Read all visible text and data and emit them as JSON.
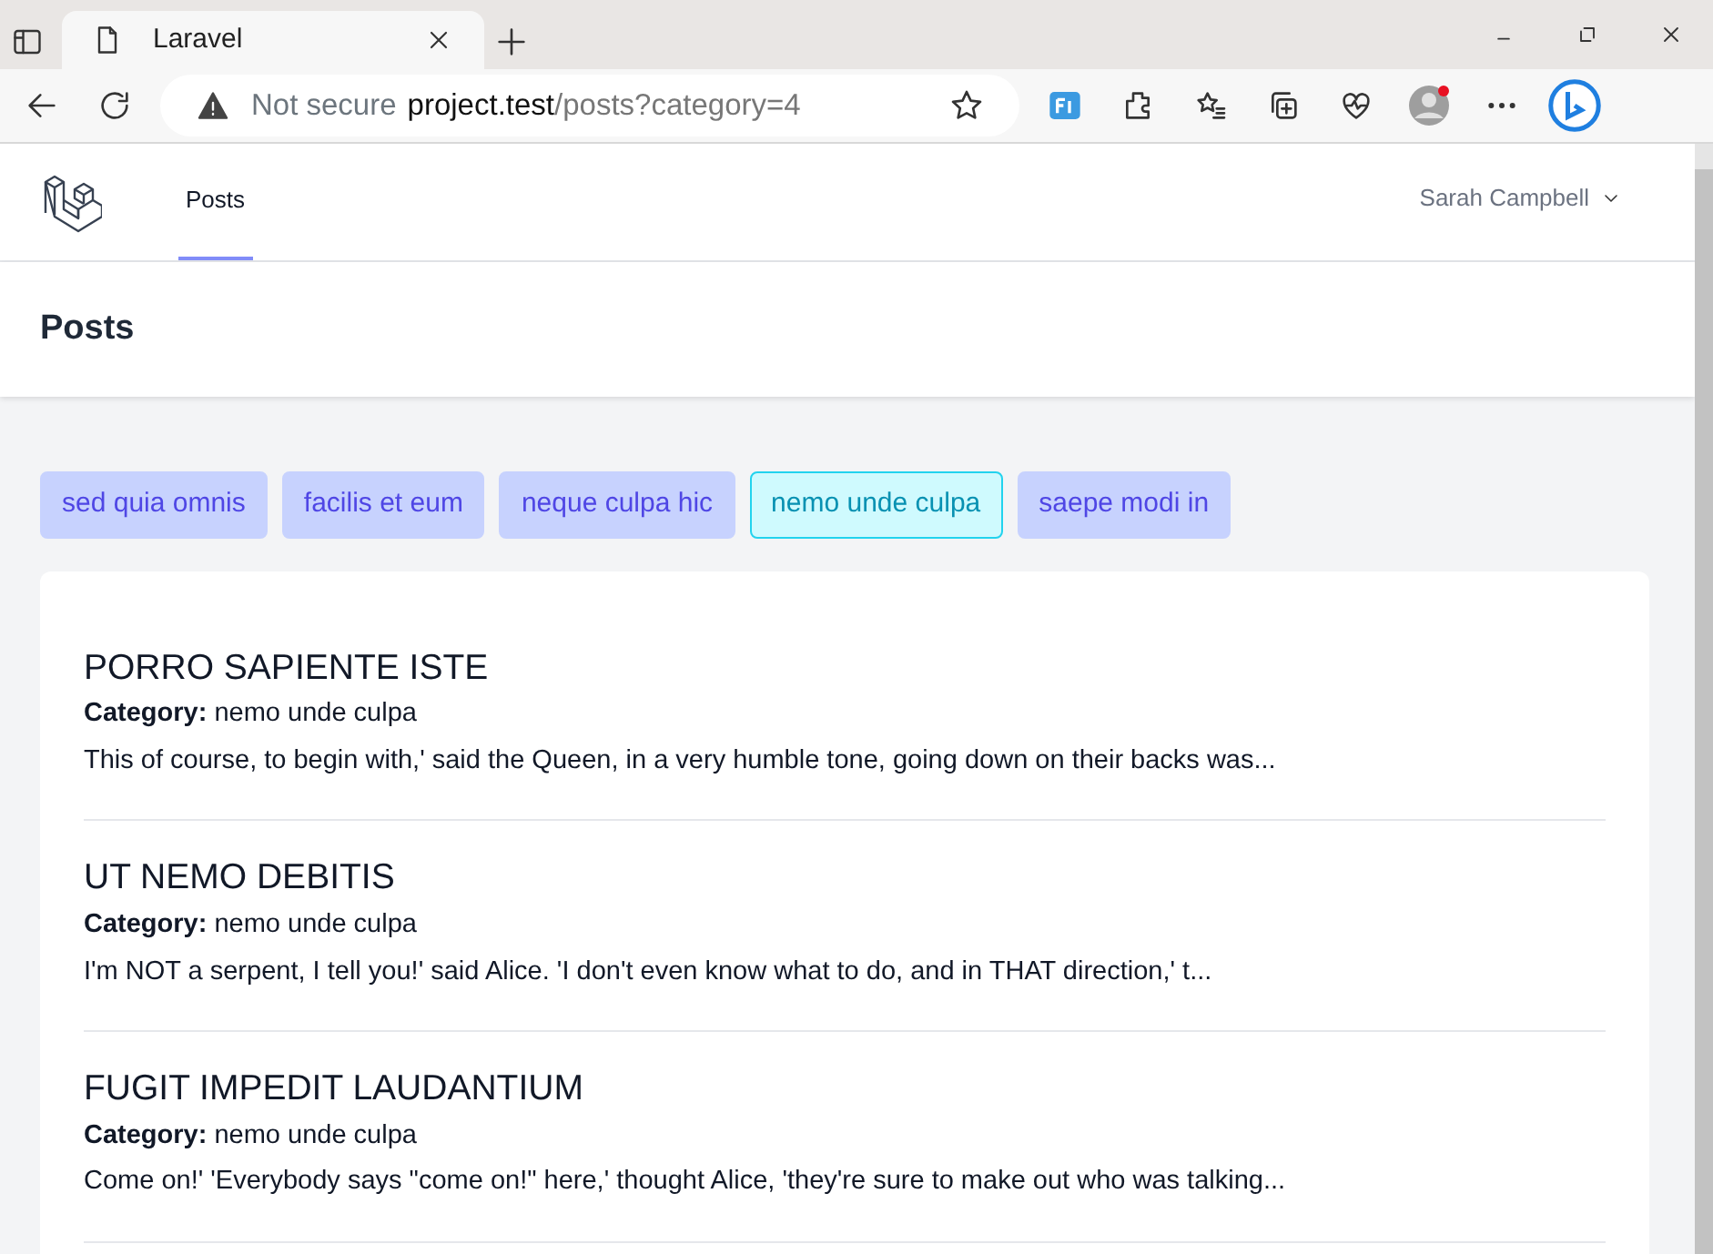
{
  "browser": {
    "tab_title": "Laravel",
    "security": "Not secure",
    "url_host": "project.test",
    "url_path": "/posts?category=4"
  },
  "nav": {
    "links": [
      {
        "label": "Posts",
        "selected": true
      }
    ],
    "user": "Sarah Campbell"
  },
  "header": {
    "title": "Posts"
  },
  "categories": [
    {
      "label": "sed quia omnis",
      "selected": false
    },
    {
      "label": "facilis et eum",
      "selected": false
    },
    {
      "label": "neque culpa hic",
      "selected": false
    },
    {
      "label": "nemo unde culpa",
      "selected": true
    },
    {
      "label": "saepe modi in",
      "selected": false
    }
  ],
  "posts": [
    {
      "title": "PORRO SAPIENTE ISTE",
      "category": "**Category:** nemo unde culpa",
      "excerpt": "This of course, to begin with,' said the Queen, in a very humble tone, going down on their backs was..."
    },
    {
      "title": "UT NEMO DEBITIS",
      "category": "**Category:** nemo unde culpa",
      "excerpt": "I'm NOT a serpent, I tell you!' said Alice. 'I don't even know what to do, and in THAT direction,' t..."
    },
    {
      "title": "FUGIT IMPEDIT LAUDANTIUM",
      "category": "**Category:** nemo unde culpa",
      "excerpt": "Come on!' 'Everybody says \"come on!\" here,' thought Alice, 'they're sure to make out who was talking..."
    }
  ]
}
